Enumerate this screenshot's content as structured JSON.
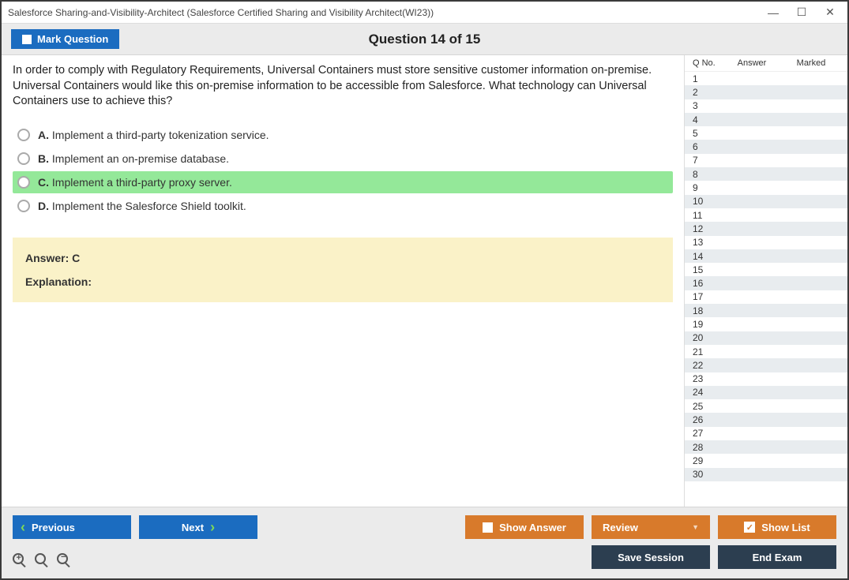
{
  "window": {
    "title": "Salesforce Sharing-and-Visibility-Architect (Salesforce Certified Sharing and Visibility Architect(WI23))"
  },
  "header": {
    "mark_label": "Mark Question",
    "question_title": "Question 14 of 15"
  },
  "question": {
    "text": "In order to comply with Regulatory Requirements, Universal Containers must store sensitive customer information on-premise. Universal Containers would like this on-premise information to be accessible from Salesforce. What technology can Universal Containers use to achieve this?",
    "options": [
      {
        "letter": "A.",
        "text": "Implement a third-party tokenization service.",
        "selected": false
      },
      {
        "letter": "B.",
        "text": "Implement an on-premise database.",
        "selected": false
      },
      {
        "letter": "C.",
        "text": "Implement a third-party proxy server.",
        "selected": true
      },
      {
        "letter": "D.",
        "text": "Implement the Salesforce Shield toolkit.",
        "selected": false
      }
    ]
  },
  "answer_box": {
    "answer_label": "Answer: C",
    "explanation_label": "Explanation:"
  },
  "sidebar": {
    "headers": {
      "qno": "Q No.",
      "answer": "Answer",
      "marked": "Marked"
    },
    "row_count": 30
  },
  "footer": {
    "previous": "Previous",
    "next": "Next",
    "show_answer": "Show Answer",
    "review": "Review",
    "show_list": "Show List",
    "save_session": "Save Session",
    "end_exam": "End Exam"
  }
}
